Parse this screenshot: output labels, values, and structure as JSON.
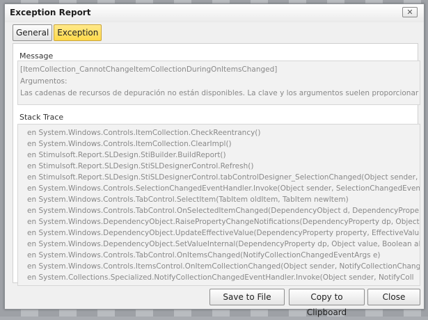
{
  "dialog": {
    "title": "Exception Report"
  },
  "tabs": [
    {
      "label": "General",
      "active": false
    },
    {
      "label": "Exception",
      "active": true
    }
  ],
  "message": {
    "label": "Message",
    "lines": [
      "[ItemCollection_CannotChangeItemCollectionDuringOnItemsChanged]",
      "Argumentos:",
      "Las cadenas de recursos de depuración no están disponibles. La clave y los argumentos suelen proporcionar"
    ]
  },
  "stack_trace": {
    "label": "Stack Trace",
    "lines": [
      "en System.Windows.Controls.ItemCollection.CheckReentrancy()",
      "en System.Windows.Controls.ItemCollection.ClearImpl()",
      "en Stimulsoft.Report.SLDesign.StiBuilder.BuildReport()",
      "en Stimulsoft.Report.SLDesign.StiSLDesignerControl.Refresh()",
      "en Stimulsoft.Report.SLDesign.StiSLDesignerControl.tabControlDesigner_SelectionChanged(Object sender,",
      "en System.Windows.Controls.SelectionChangedEventHandler.Invoke(Object sender, SelectionChangedEventArgs",
      "en System.Windows.Controls.TabControl.SelectItem(TabItem oldItem, TabItem newItem)",
      "en System.Windows.Controls.TabControl.OnSelectedItemChanged(DependencyObject d, DependencyPropertyChanged",
      "en System.Windows.DependencyObject.RaisePropertyChangeNotifications(DependencyProperty dp, Object old",
      "en System.Windows.DependencyObject.UpdateEffectiveValue(DependencyProperty property, EffectiveValueEntry",
      "en System.Windows.DependencyObject.SetValueInternal(DependencyProperty dp, Object value, Boolean allow",
      "en System.Windows.Controls.TabControl.OnItemsChanged(NotifyCollectionChangedEventArgs e)",
      "en System.Windows.Controls.ItemsControl.OnItemCollectionChanged(Object sender, NotifyCollectionChanged",
      "en System.Collections.Specialized.NotifyCollectionChangedEventHandler.Invoke(Object sender, NotifyColl"
    ]
  },
  "buttons": {
    "save": "Save to File",
    "copy": "Copy to Clipboard",
    "close": "Close"
  },
  "icons": {
    "close": "close-x-icon"
  },
  "colors": {
    "active_tab": "#ffd94a",
    "panel_bg": "#ffffff",
    "box_bg": "#f2f2f2"
  }
}
